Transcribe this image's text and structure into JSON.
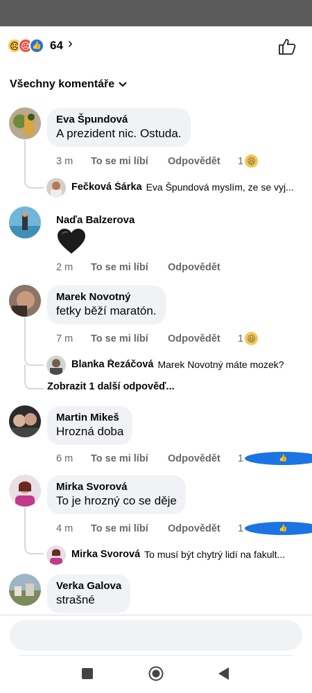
{
  "reactions": {
    "emojis": [
      "sad-icon",
      "angry-icon",
      "like-icon"
    ],
    "count": "64"
  },
  "filter": {
    "label": "Všechny komentáře"
  },
  "comments": [
    {
      "author": "Eva Špundová",
      "text": "A prezident nic. Ostuda.",
      "time": "3 m",
      "like": "To se mi líbí",
      "reply": "Odpovědět",
      "reaction_count": "1",
      "reaction": "haha-icon",
      "replies": [
        {
          "author": "Fečková Šárka",
          "text": "Eva Špundová myslím, ze se vyj..."
        }
      ]
    },
    {
      "author": "Naďa Balzerova",
      "text": "",
      "sticker": "black-heart",
      "time": "2 m",
      "like": "To se mi líbí",
      "reply": "Odpovědět"
    },
    {
      "author": "Marek Novotný",
      "text": "fetky běží maratón.",
      "time": "7 m",
      "like": "To se mi líbí",
      "reply": "Odpovědět",
      "reaction_count": "1",
      "reaction": "haha-icon",
      "replies": [
        {
          "author": "Blanka Řezáčová",
          "text": "Marek Novotný máte mozek?"
        }
      ],
      "more": "Zobrazit 1 další odpověď..."
    },
    {
      "author": "Martin Mikeš",
      "text": "Hrozná doba",
      "time": "6 m",
      "like": "To se mi líbí",
      "reply": "Odpovědět",
      "reaction_count": "1",
      "reaction": "like-icon"
    },
    {
      "author": "Mirka Svorová",
      "text": "To je hrozný co se děje",
      "time": "4 m",
      "like": "To se mi líbí",
      "reply": "Odpovědět",
      "reaction_count": "1",
      "reaction": "like-icon",
      "replies": [
        {
          "author": "Mirka Svorová",
          "text": "To musí být chytrý lidí na fakult..."
        }
      ]
    },
    {
      "author": "Verka Galova",
      "text": "strašné"
    }
  ],
  "input": {
    "placeholder": ""
  },
  "colors": {
    "accent": "#1b74e4",
    "bubble": "#f0f2f5",
    "meta": "#65676b"
  }
}
